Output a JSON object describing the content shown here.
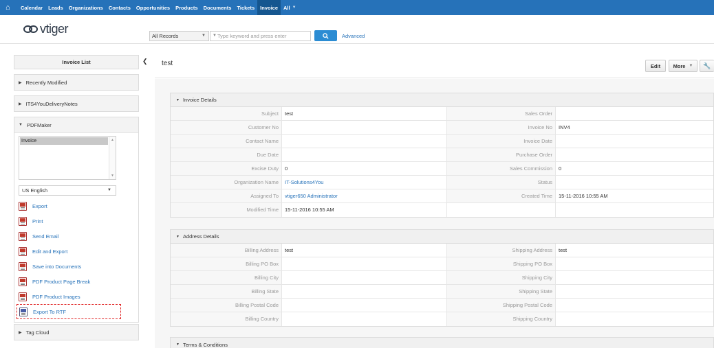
{
  "topnav": {
    "home_icon": "home-icon",
    "items": [
      "Calendar",
      "Leads",
      "Organizations",
      "Contacts",
      "Opportunities",
      "Products",
      "Documents",
      "Tickets",
      "Invoice",
      "All"
    ],
    "active": "Invoice",
    "accent": "#2672b9"
  },
  "header": {
    "logo_text": "vtiger",
    "records_select": "All Records",
    "search_placeholder": "Type keyword and press enter",
    "advanced": "Advanced"
  },
  "sidebar": {
    "title": "Invoice List",
    "recently_modified": "Recently Modified",
    "delivery_notes": "ITS4YouDeliveryNotes",
    "pdfmaker": "PDFMaker",
    "template_selected": "Invoice",
    "language": "US English",
    "actions": [
      {
        "label": "Export",
        "icon": "pdf-export-icon"
      },
      {
        "label": "Print",
        "icon": "pdf-print-icon"
      },
      {
        "label": "Send Email",
        "icon": "pdf-email-icon"
      },
      {
        "label": "Edit and Export",
        "icon": "pdf-edit-icon"
      },
      {
        "label": "Save into Documents",
        "icon": "pdf-save-icon"
      },
      {
        "label": "PDF Product Page Break",
        "icon": "pdf-pagebreak-icon"
      },
      {
        "label": "PDF Product Images",
        "icon": "pdf-images-icon"
      },
      {
        "label": "Export To RTF",
        "icon": "rtf-export-icon"
      }
    ],
    "tag_cloud": "Tag Cloud"
  },
  "record": {
    "title": "test",
    "edit": "Edit",
    "more": "More"
  },
  "invoice_details": {
    "heading": "Invoice Details",
    "rows": [
      {
        "l1": "Subject",
        "v1": "test",
        "l2": "Sales Order",
        "v2": ""
      },
      {
        "l1": "Customer No",
        "v1": "",
        "l2": "Invoice No",
        "v2": "INV4"
      },
      {
        "l1": "Contact Name",
        "v1": "",
        "l2": "Invoice Date",
        "v2": ""
      },
      {
        "l1": "Due Date",
        "v1": "",
        "l2": "Purchase Order",
        "v2": ""
      },
      {
        "l1": "Excise Duty",
        "v1": "0",
        "l2": "Sales Commission",
        "v2": "0"
      },
      {
        "l1": "Organization Name",
        "v1": "IT-Solutions4You",
        "l2": "Status",
        "v2": ""
      },
      {
        "l1": "Assigned To",
        "v1": "vtiger650 Administrator",
        "l2": "Created Time",
        "v2": "15-11-2016 10:55 AM"
      },
      {
        "l1": "Modified Time",
        "v1": "15-11-2016 10:55 AM",
        "l2": "",
        "v2": ""
      }
    ]
  },
  "address_details": {
    "heading": "Address Details",
    "rows": [
      {
        "l1": "Billing Address",
        "v1": "test",
        "l2": "Shipping Address",
        "v2": "test"
      },
      {
        "l1": "Billing PO Box",
        "v1": "",
        "l2": "Shipping PO Box",
        "v2": ""
      },
      {
        "l1": "Billing City",
        "v1": "",
        "l2": "Shipping City",
        "v2": ""
      },
      {
        "l1": "Billing State",
        "v1": "",
        "l2": "Shipping State",
        "v2": ""
      },
      {
        "l1": "Billing Postal Code",
        "v1": "",
        "l2": "Shipping Postal Code",
        "v2": ""
      },
      {
        "l1": "Billing Country",
        "v1": "",
        "l2": "Shipping Country",
        "v2": ""
      }
    ]
  },
  "terms": {
    "heading": "Terms & Conditions"
  }
}
